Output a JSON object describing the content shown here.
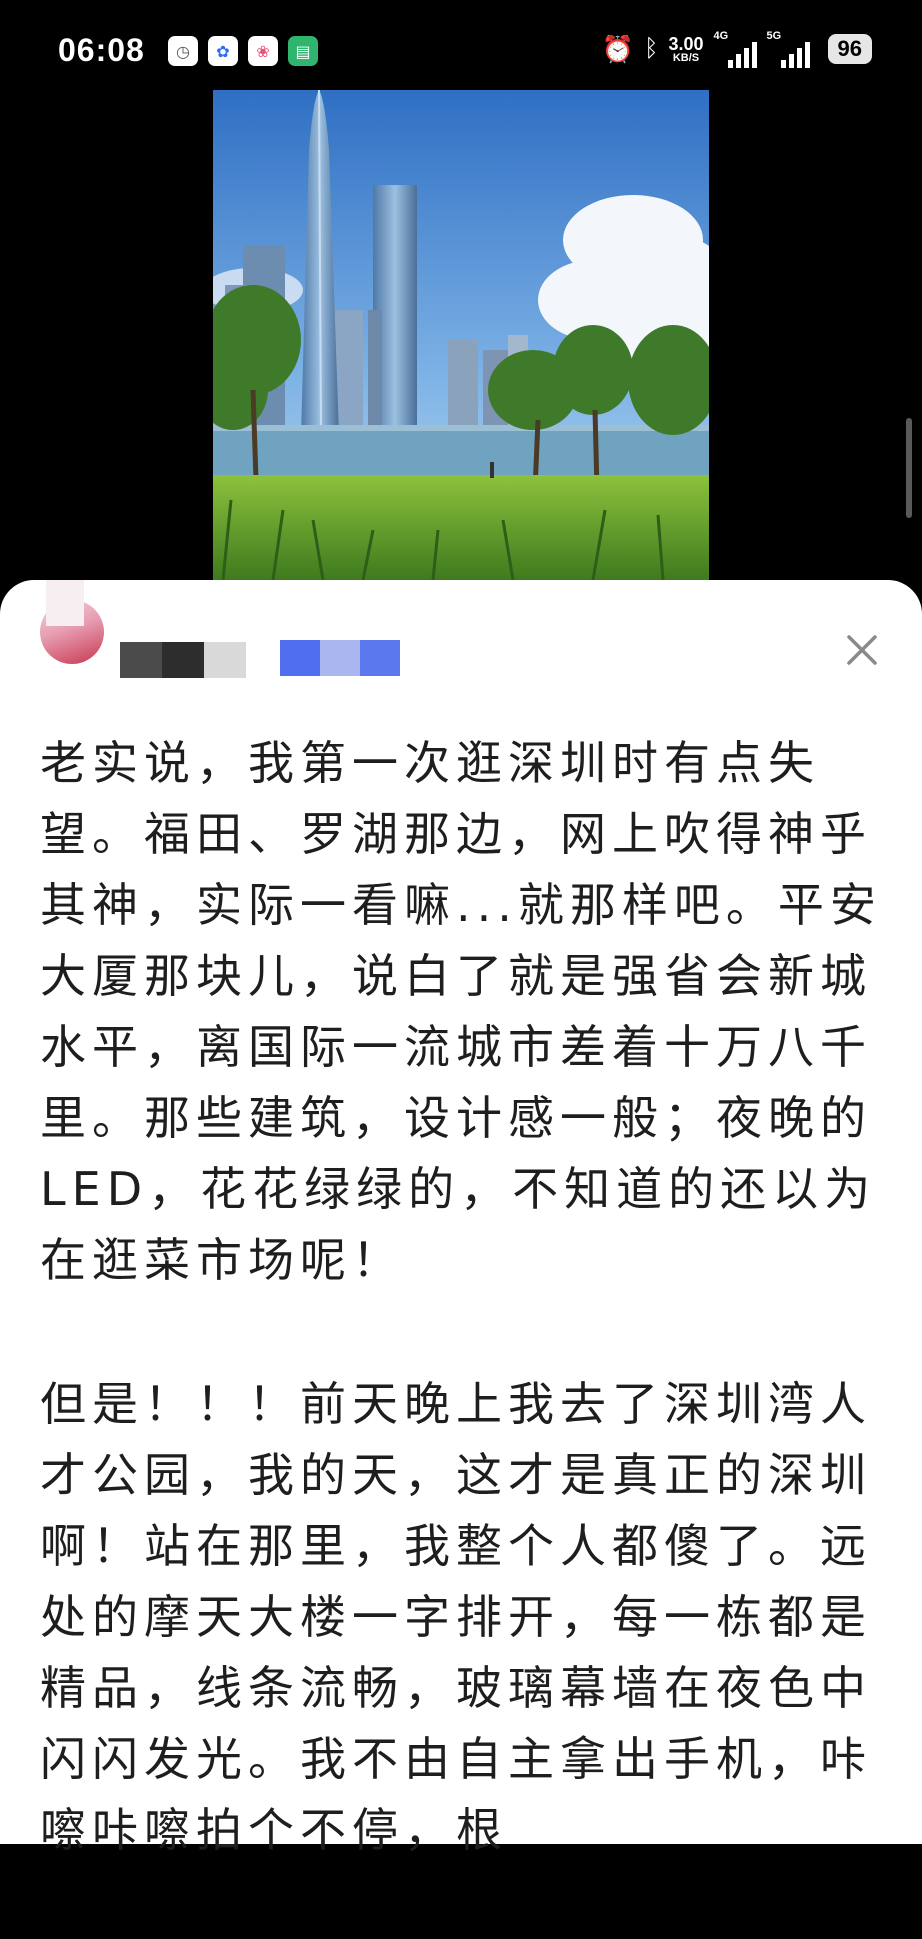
{
  "status_bar": {
    "time": "06:08",
    "net_speed_value": "3.00",
    "net_speed_unit": "KB/S",
    "sim1_label": "4G",
    "sim2_label": "5G",
    "battery": "96",
    "icons": [
      "alarm-icon",
      "bluetooth-icon",
      "signal-icon"
    ]
  },
  "app_icons": [
    "clock-app-icon",
    "baidu-app-icon",
    "photos-app-icon",
    "docs-app-icon"
  ],
  "comment": {
    "paragraphs": [
      "老实说，我第一次逛深圳时有点失望。福田、罗湖那边，网上吹得神乎其神，实际一看嘛...就那样吧。平安大厦那块儿，说白了就是强省会新城水平，离国际一流城市差着十万八千里。那些建筑，设计感一般；夜晚的LED，花花绿绿的，不知道的还以为在逛菜市场呢！",
      "但是！！！前天晚上我去了深圳湾人才公园，我的天，这才是真正的深圳啊！站在那里，我整个人都傻了。远处的摩天大楼一字排开，每一栋都是精品，线条流畅，玻璃幕墙在夜色中闪闪发光。我不由自主拿出手机，咔嚓咔嚓拍个不停，根"
    ]
  },
  "colors": {
    "accent_blue": "#4f6ef0",
    "close_icon": "#8a8a8a"
  }
}
